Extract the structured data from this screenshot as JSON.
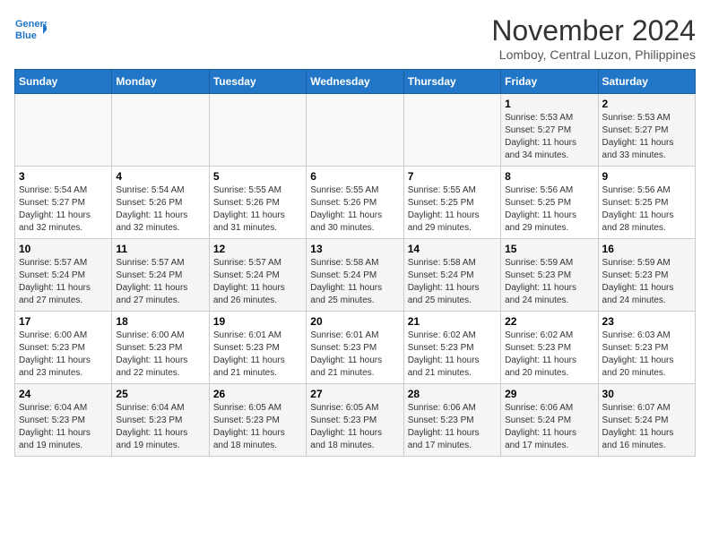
{
  "header": {
    "logo_line1": "General",
    "logo_line2": "Blue",
    "month": "November 2024",
    "location": "Lomboy, Central Luzon, Philippines"
  },
  "weekdays": [
    "Sunday",
    "Monday",
    "Tuesday",
    "Wednesday",
    "Thursday",
    "Friday",
    "Saturday"
  ],
  "weeks": [
    [
      {
        "day": "",
        "info": ""
      },
      {
        "day": "",
        "info": ""
      },
      {
        "day": "",
        "info": ""
      },
      {
        "day": "",
        "info": ""
      },
      {
        "day": "",
        "info": ""
      },
      {
        "day": "1",
        "info": "Sunrise: 5:53 AM\nSunset: 5:27 PM\nDaylight: 11 hours\nand 34 minutes."
      },
      {
        "day": "2",
        "info": "Sunrise: 5:53 AM\nSunset: 5:27 PM\nDaylight: 11 hours\nand 33 minutes."
      }
    ],
    [
      {
        "day": "3",
        "info": "Sunrise: 5:54 AM\nSunset: 5:27 PM\nDaylight: 11 hours\nand 32 minutes."
      },
      {
        "day": "4",
        "info": "Sunrise: 5:54 AM\nSunset: 5:26 PM\nDaylight: 11 hours\nand 32 minutes."
      },
      {
        "day": "5",
        "info": "Sunrise: 5:55 AM\nSunset: 5:26 PM\nDaylight: 11 hours\nand 31 minutes."
      },
      {
        "day": "6",
        "info": "Sunrise: 5:55 AM\nSunset: 5:26 PM\nDaylight: 11 hours\nand 30 minutes."
      },
      {
        "day": "7",
        "info": "Sunrise: 5:55 AM\nSunset: 5:25 PM\nDaylight: 11 hours\nand 29 minutes."
      },
      {
        "day": "8",
        "info": "Sunrise: 5:56 AM\nSunset: 5:25 PM\nDaylight: 11 hours\nand 29 minutes."
      },
      {
        "day": "9",
        "info": "Sunrise: 5:56 AM\nSunset: 5:25 PM\nDaylight: 11 hours\nand 28 minutes."
      }
    ],
    [
      {
        "day": "10",
        "info": "Sunrise: 5:57 AM\nSunset: 5:24 PM\nDaylight: 11 hours\nand 27 minutes."
      },
      {
        "day": "11",
        "info": "Sunrise: 5:57 AM\nSunset: 5:24 PM\nDaylight: 11 hours\nand 27 minutes."
      },
      {
        "day": "12",
        "info": "Sunrise: 5:57 AM\nSunset: 5:24 PM\nDaylight: 11 hours\nand 26 minutes."
      },
      {
        "day": "13",
        "info": "Sunrise: 5:58 AM\nSunset: 5:24 PM\nDaylight: 11 hours\nand 25 minutes."
      },
      {
        "day": "14",
        "info": "Sunrise: 5:58 AM\nSunset: 5:24 PM\nDaylight: 11 hours\nand 25 minutes."
      },
      {
        "day": "15",
        "info": "Sunrise: 5:59 AM\nSunset: 5:23 PM\nDaylight: 11 hours\nand 24 minutes."
      },
      {
        "day": "16",
        "info": "Sunrise: 5:59 AM\nSunset: 5:23 PM\nDaylight: 11 hours\nand 24 minutes."
      }
    ],
    [
      {
        "day": "17",
        "info": "Sunrise: 6:00 AM\nSunset: 5:23 PM\nDaylight: 11 hours\nand 23 minutes."
      },
      {
        "day": "18",
        "info": "Sunrise: 6:00 AM\nSunset: 5:23 PM\nDaylight: 11 hours\nand 22 minutes."
      },
      {
        "day": "19",
        "info": "Sunrise: 6:01 AM\nSunset: 5:23 PM\nDaylight: 11 hours\nand 21 minutes."
      },
      {
        "day": "20",
        "info": "Sunrise: 6:01 AM\nSunset: 5:23 PM\nDaylight: 11 hours\nand 21 minutes."
      },
      {
        "day": "21",
        "info": "Sunrise: 6:02 AM\nSunset: 5:23 PM\nDaylight: 11 hours\nand 21 minutes."
      },
      {
        "day": "22",
        "info": "Sunrise: 6:02 AM\nSunset: 5:23 PM\nDaylight: 11 hours\nand 20 minutes."
      },
      {
        "day": "23",
        "info": "Sunrise: 6:03 AM\nSunset: 5:23 PM\nDaylight: 11 hours\nand 20 minutes."
      }
    ],
    [
      {
        "day": "24",
        "info": "Sunrise: 6:04 AM\nSunset: 5:23 PM\nDaylight: 11 hours\nand 19 minutes."
      },
      {
        "day": "25",
        "info": "Sunrise: 6:04 AM\nSunset: 5:23 PM\nDaylight: 11 hours\nand 19 minutes."
      },
      {
        "day": "26",
        "info": "Sunrise: 6:05 AM\nSunset: 5:23 PM\nDaylight: 11 hours\nand 18 minutes."
      },
      {
        "day": "27",
        "info": "Sunrise: 6:05 AM\nSunset: 5:23 PM\nDaylight: 11 hours\nand 18 minutes."
      },
      {
        "day": "28",
        "info": "Sunrise: 6:06 AM\nSunset: 5:23 PM\nDaylight: 11 hours\nand 17 minutes."
      },
      {
        "day": "29",
        "info": "Sunrise: 6:06 AM\nSunset: 5:24 PM\nDaylight: 11 hours\nand 17 minutes."
      },
      {
        "day": "30",
        "info": "Sunrise: 6:07 AM\nSunset: 5:24 PM\nDaylight: 11 hours\nand 16 minutes."
      }
    ]
  ]
}
